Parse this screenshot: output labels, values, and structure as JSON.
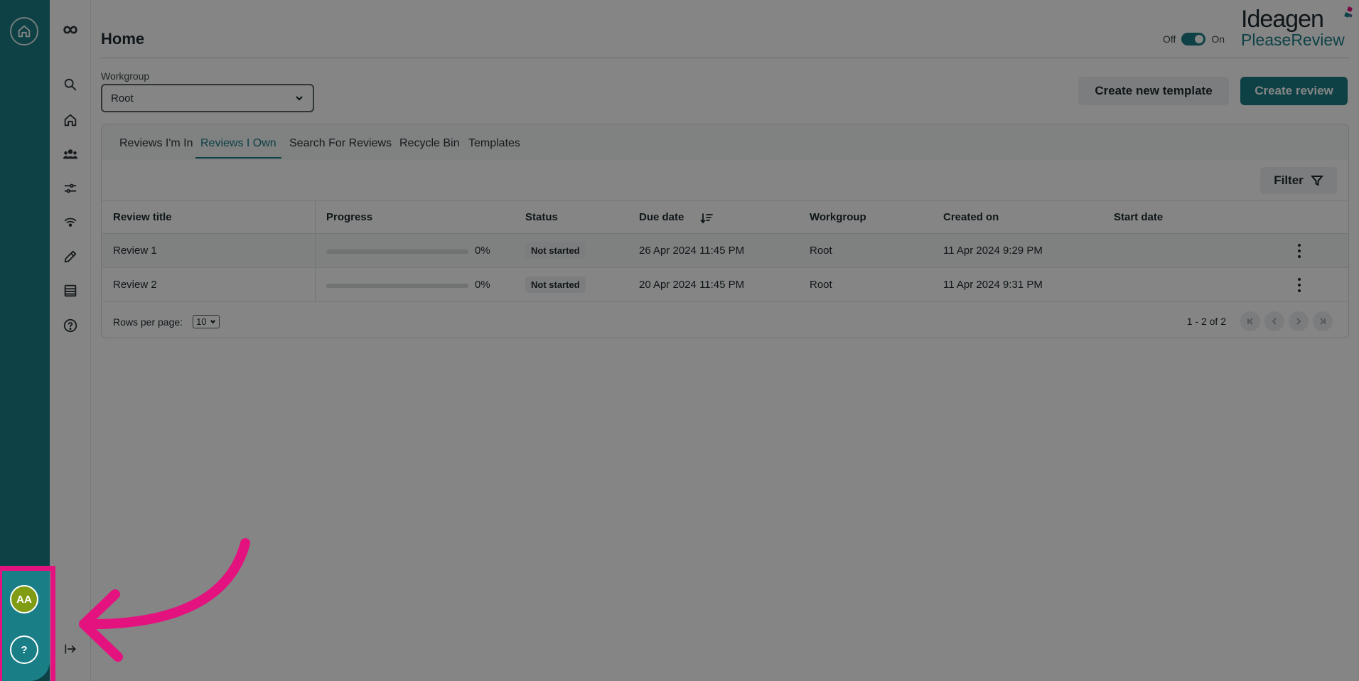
{
  "app": {
    "page_title": "Home",
    "brand_name": "Ideagen",
    "brand_product": "PleaseReview",
    "toggle": {
      "off_label": "Off",
      "on_label": "On",
      "state": "on"
    },
    "accent_color": "#1a7e86"
  },
  "rail": {
    "home_icon": "home-circle-icon",
    "avatar_initials": "AA",
    "help_label": "?"
  },
  "sidebar": {
    "items": [
      {
        "name": "logo-icon"
      },
      {
        "name": "search-icon"
      },
      {
        "name": "home-icon"
      },
      {
        "name": "users-icon"
      },
      {
        "name": "settings-sliders-icon"
      },
      {
        "name": "light-bulb-icon"
      },
      {
        "name": "pencil-icon"
      },
      {
        "name": "list-icon"
      },
      {
        "name": "help-icon"
      }
    ],
    "collapse_icon": "expand-arrow-icon"
  },
  "workgroup": {
    "label": "Workgroup",
    "selected": "Root"
  },
  "actions": {
    "create_template": "Create new template",
    "create_review": "Create review"
  },
  "tabs": [
    {
      "label": "Reviews I'm In",
      "active": false
    },
    {
      "label": "Reviews I Own",
      "active": true
    },
    {
      "label": "Search For Reviews",
      "active": false
    },
    {
      "label": "Recycle Bin",
      "active": false
    },
    {
      "label": "Templates",
      "active": false
    }
  ],
  "filter_label": "Filter",
  "table": {
    "columns": [
      "Review title",
      "Progress",
      "Status",
      "Due date",
      "Workgroup",
      "Created on",
      "Start date"
    ],
    "rows": [
      {
        "title": "Review 1",
        "progress": 0,
        "progress_label": "0%",
        "status": "Not started",
        "due": "26 Apr 2024 11:45 PM",
        "workgroup": "Root",
        "created": "11 Apr 2024 9:29 PM",
        "start": ""
      },
      {
        "title": "Review 2",
        "progress": 0,
        "progress_label": "0%",
        "status": "Not started",
        "due": "20 Apr 2024 11:45 PM",
        "workgroup": "Root",
        "created": "11 Apr 2024 9:31 PM",
        "start": ""
      }
    ]
  },
  "pagination": {
    "rows_per_page_label": "Rows per page:",
    "rows_per_page": "10",
    "range": "1 - 2 of 2"
  },
  "annotation": {
    "highlight_color": "#e4127e"
  }
}
